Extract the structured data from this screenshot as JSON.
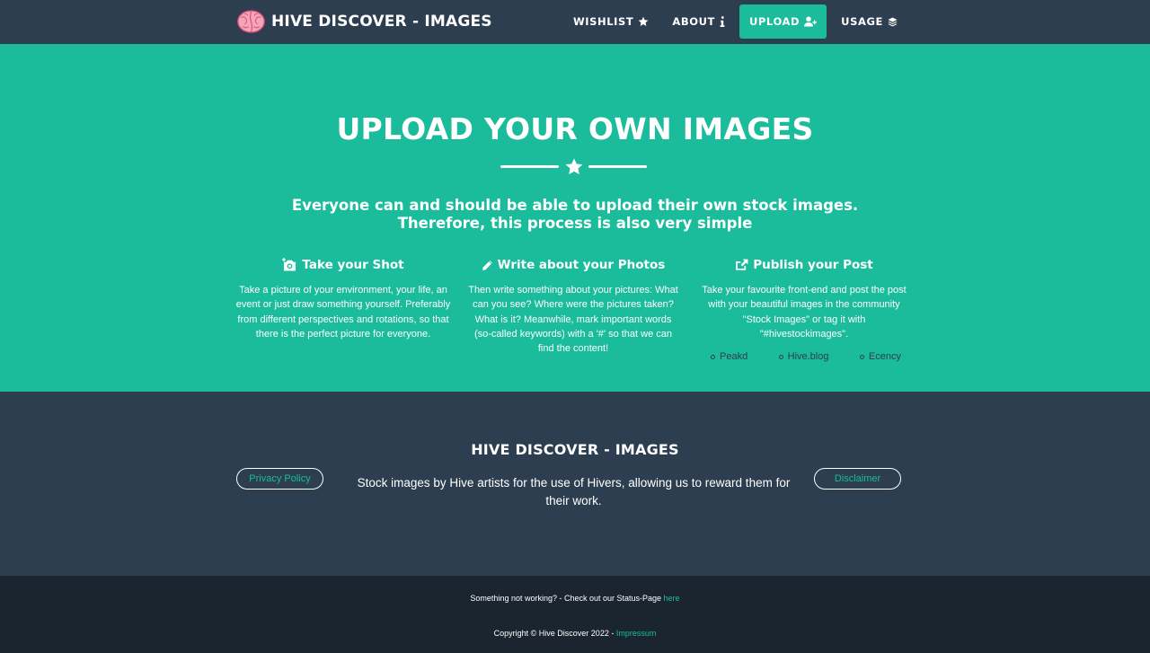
{
  "navbar": {
    "brand": "HIVE DISCOVER - IMAGES",
    "items": [
      {
        "label": "WISHLIST",
        "icon": "star-icon"
      },
      {
        "label": "ABOUT",
        "icon": "info-icon"
      },
      {
        "label": "UPLOAD",
        "icon": "user-plus-icon",
        "active": true
      },
      {
        "label": "USAGE",
        "icon": "layers-icon"
      }
    ]
  },
  "masthead": {
    "title": "UPLOAD YOUR OWN IMAGES",
    "lead": "Everyone can and should be able to upload their own stock images. Therefore, this process is also very simple",
    "columns": [
      {
        "icon": "camera-icon",
        "heading": "Take your Shot",
        "text": "Take a picture of your environment, your life, an event or just draw something yourself. Preferably from different perspectives and rotations, so that there is the perfect picture for everyone."
      },
      {
        "icon": "pencil-icon",
        "heading": "Write about your Photos",
        "text": "Then write something about your pictures: What can you see? Where were the pictures taken? What is it? Meanwhile, mark important words (so-called keywords) with a '#' so that we can find the content!"
      },
      {
        "icon": "share-icon",
        "heading": "Publish your Post",
        "text": "Take your favourite front-end and post the post with your beautiful images in the community \"Stock Images\" or tag it with \"#hivestockimages\".",
        "platforms": [
          "Peakd",
          "Hive.blog",
          "Ecency"
        ]
      }
    ]
  },
  "footer": {
    "title": "HIVE DISCOVER - IMAGES",
    "tagline": "Stock images by Hive artists for the use of Hivers, allowing us to reward them for their work.",
    "privacy": "Privacy Policy",
    "disclaimer": "Disclaimer"
  },
  "copyright": {
    "status_text": "Something not working? - Check out our Status-Page ",
    "status_link": "here",
    "copy_text": "Copyright © Hive Discover 2022 - ",
    "impressum": "Impressum"
  },
  "colors": {
    "primary": "#2c3e50",
    "accent": "#1abc9c",
    "dark": "#1a252f"
  }
}
